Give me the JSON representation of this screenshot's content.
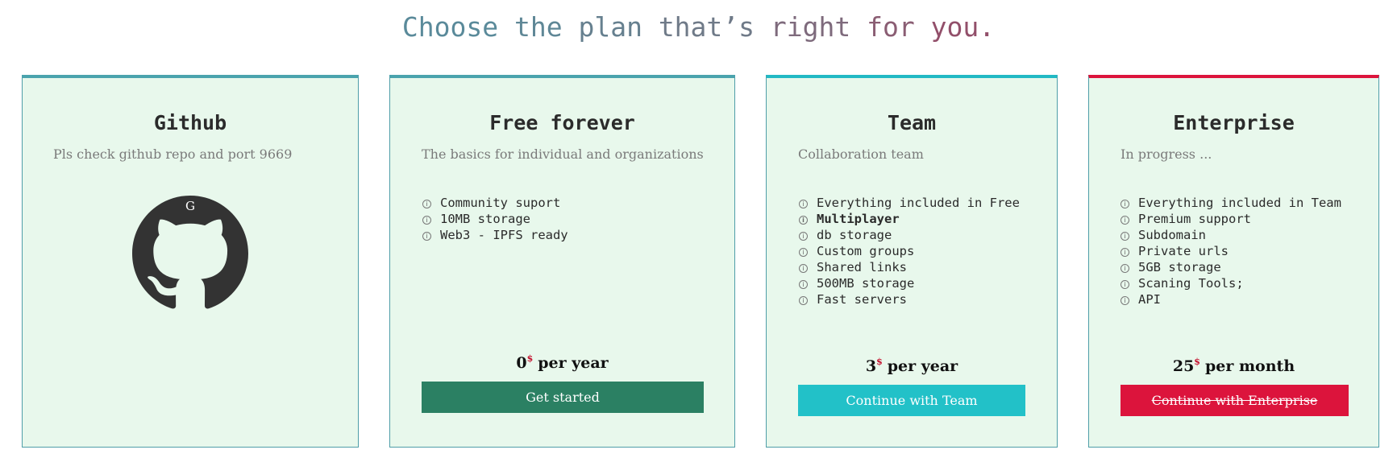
{
  "headline": {
    "words": [
      {
        "text": "Choose ",
        "color": "#5a8a9a"
      },
      {
        "text": "the ",
        "color": "#5f8796"
      },
      {
        "text": "plan ",
        "color": "#66808f"
      },
      {
        "text": "that’s ",
        "color": "#6f7a88"
      },
      {
        "text": "right ",
        "color": "#7e6a7c"
      },
      {
        "text": "for ",
        "color": "#8a5d73"
      },
      {
        "text": "you.",
        "color": "#924f6a"
      }
    ]
  },
  "cards": {
    "github": {
      "title": "Github",
      "subtitle": "Pls check github repo and port 9669",
      "logo_letter": "G",
      "logo_icon": "github-octocat-icon",
      "accent": "#4aa3ad"
    },
    "free": {
      "title": "Free forever",
      "subtitle": "The basics for individual and organizations",
      "features": [
        "Community suport",
        "10MB storage",
        "Web3 - IPFS ready"
      ],
      "price_amount": "0",
      "price_currency": "$",
      "price_period": "per year",
      "button_label": "Get started",
      "button_color": "#2b8063",
      "accent": "#4aa3ad"
    },
    "team": {
      "title": "Team",
      "subtitle": "Collaboration team",
      "features": [
        "Everything included in Free",
        "Multiplayer",
        "db storage",
        "Custom groups",
        "Shared links",
        "500MB storage",
        "Fast servers"
      ],
      "price_amount": "3",
      "price_currency": "$",
      "price_period": "per year",
      "button_label": "Continue with Team",
      "button_color": "#22c1c8",
      "accent": "#22b9c4"
    },
    "enterprise": {
      "title": "Enterprise",
      "subtitle": "In progress ...",
      "features": [
        "Everything included in Team",
        "Premium support",
        "Subdomain",
        "Private urls",
        "5GB storage",
        "Scaning Tools;",
        "API"
      ],
      "price_amount": "25",
      "price_currency": "$",
      "price_period": "per month",
      "button_label": "Continue with Enterprise",
      "button_color": "#dc143c",
      "accent": "#dc143c"
    }
  },
  "icons": {
    "feature_icon": "info-icon"
  }
}
